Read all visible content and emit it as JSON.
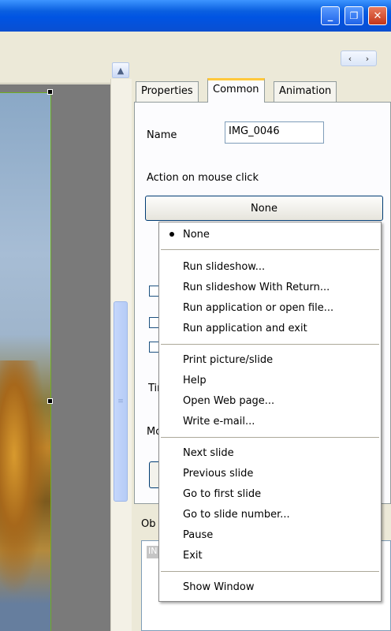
{
  "window": {
    "minimize_glyph": "_",
    "maximize_glyph": "❐",
    "close_glyph": "✕"
  },
  "toolbar": {
    "nav_prev": "‹",
    "nav_next": "›"
  },
  "scrollbar": {
    "up_glyph": "▲",
    "thumb_grip": "≡"
  },
  "tabs": [
    {
      "label": "Properties",
      "active": false
    },
    {
      "label": "Common",
      "active": true
    },
    {
      "label": "Animation",
      "active": false
    }
  ],
  "common": {
    "name_label": "Name",
    "name_value": "IMG_0046",
    "action_label": "Action on mouse click",
    "action_value": "None",
    "partial_label_1": "Tir",
    "partial_label_2": "Mo",
    "objects_label": "Ob",
    "objects_item": "IN"
  },
  "menu": {
    "groups": [
      [
        "None"
      ],
      [
        "Run slideshow...",
        "Run slideshow With Return...",
        "Run application or open file...",
        "Run application and exit"
      ],
      [
        "Print picture/slide",
        "Help",
        "Open Web page...",
        "Write e-mail..."
      ],
      [
        "Next slide",
        "Previous slide",
        "Go to first slide",
        "Go to slide number...",
        "Pause",
        "Exit"
      ],
      [
        "Show Window"
      ]
    ],
    "selected": "None"
  }
}
